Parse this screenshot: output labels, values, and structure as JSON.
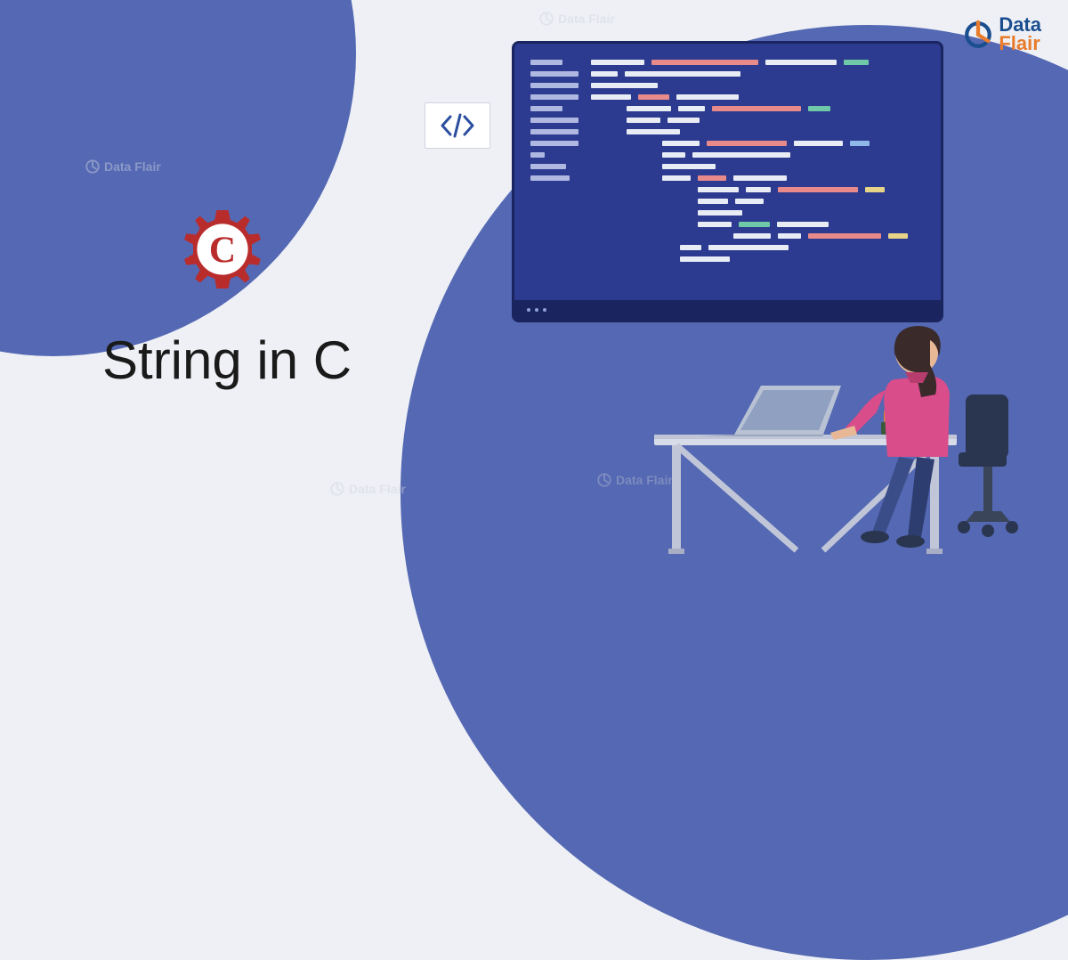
{
  "title": "String in C",
  "logo": {
    "text_top": "Data",
    "text_bottom": "Flair"
  },
  "watermark_text": "Data Flair",
  "code_tag_symbol": "</>",
  "gear_letter": "C",
  "colors": {
    "bg_blue": "#5468b3",
    "bg_light": "#eef0f5",
    "code_bg": "#2c3a8f",
    "gear_red": "#b92c2c",
    "logo_blue": "#1a4e8f",
    "logo_orange": "#e87b2c"
  }
}
